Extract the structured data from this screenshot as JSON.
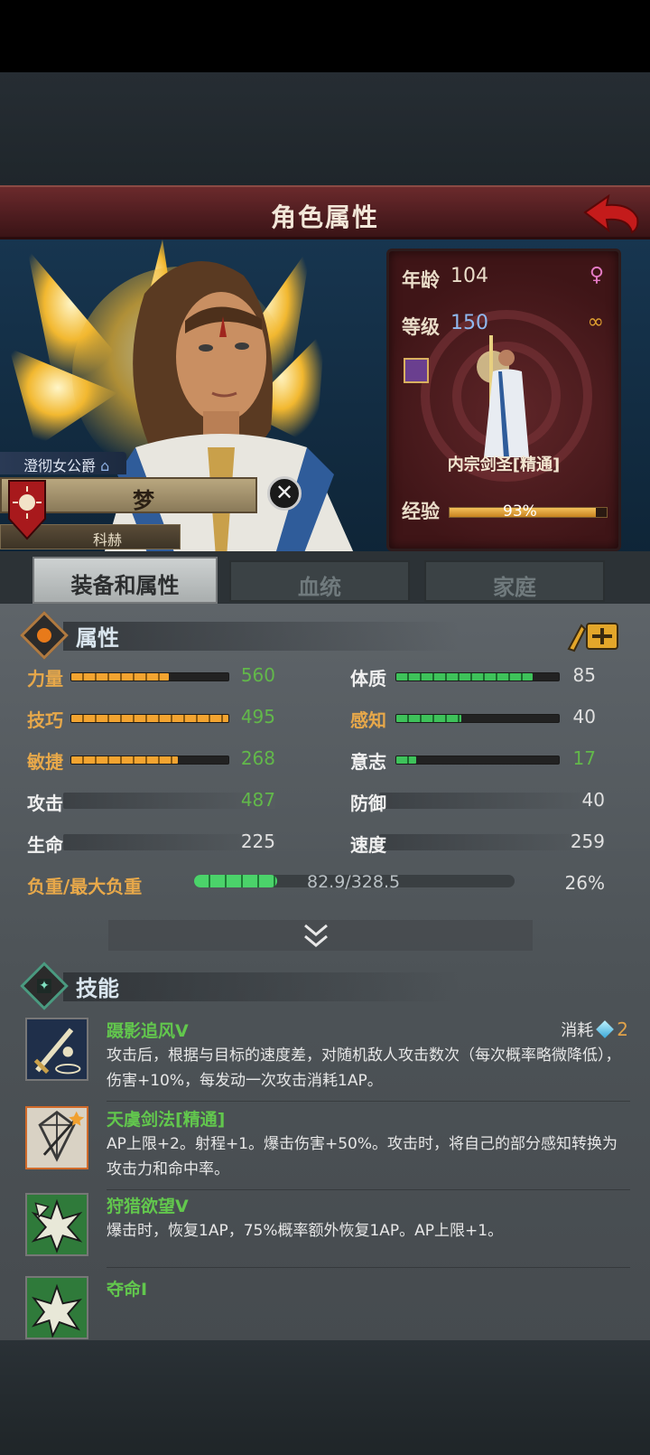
{
  "header": {
    "title": "角色属性"
  },
  "character": {
    "noble_title": "澄彻女公爵",
    "name": "梦",
    "house": "科赫"
  },
  "info": {
    "age_label": "年龄",
    "age": "104",
    "level_label": "等级",
    "level": "150",
    "class_name": "内宗剑圣[精通]",
    "exp_label": "经验",
    "exp_pct": "93%",
    "exp_fraction": 0.93
  },
  "tabs": [
    {
      "label": "装备和属性",
      "active": true
    },
    {
      "label": "血统",
      "active": false
    },
    {
      "label": "家庭",
      "active": false
    }
  ],
  "attributes": {
    "title": "属性",
    "bars": [
      {
        "label": "力量",
        "value": "560",
        "fill": 0.62,
        "color": "orange"
      },
      {
        "label": "技巧",
        "value": "495",
        "fill": 1.0,
        "color": "orange"
      },
      {
        "label": "敏捷",
        "value": "268",
        "fill": 0.68,
        "color": "orange"
      },
      {
        "label": "体质",
        "value": "85",
        "fill": 0.84,
        "color": "green"
      },
      {
        "label": "感知",
        "value": "40",
        "fill": 0.4,
        "color": "green"
      },
      {
        "label": "意志",
        "value": "17",
        "fill": 0.12,
        "color": "green"
      }
    ],
    "plain": [
      {
        "label": "攻击",
        "value": "487"
      },
      {
        "label": "生命",
        "value": "225"
      },
      {
        "label": "防御",
        "value": "40"
      },
      {
        "label": "速度",
        "value": "259"
      }
    ],
    "load_label": "负重/最大负重",
    "load_value": "82.9/328.5",
    "load_pct": "26%",
    "load_fraction": 0.26
  },
  "skills": {
    "title": "技能",
    "cost_label": "消耗",
    "cost_value": "2",
    "items": [
      {
        "name": "蹑影追风V",
        "desc": "攻击后，根据与目标的速度差，对随机敌人攻击数次（每次概率略微降低），伤害+10%，每发动一次攻击消耗1AP。"
      },
      {
        "name": "天虞剑法[精通]",
        "desc": "AP上限+2。射程+1。爆击伤害+50%。攻击时，将自己的部分感知转换为攻击力和命中率。"
      },
      {
        "name": "狩猎欲望V",
        "desc": "爆击时，恢复1AP，75%概率额外恢复1AP。AP上限+1。"
      },
      {
        "name": "夺命I",
        "desc": ""
      }
    ]
  },
  "colors": {
    "title_bar": "#4d1c1f",
    "orange_bar": "#f3a430",
    "green_bar": "#3ec25a",
    "skill_name": "#62c74d",
    "value_green": "#62b84a"
  }
}
